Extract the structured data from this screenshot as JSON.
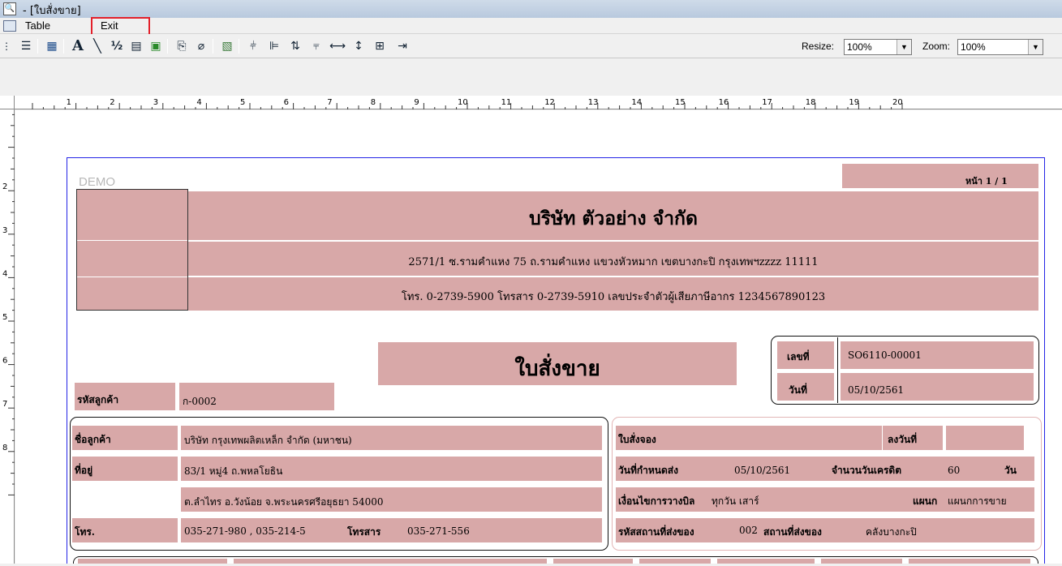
{
  "window": {
    "icon": "print-preview-icon",
    "title": "- [ใบสั่งขาย]"
  },
  "menu": {
    "items": [
      "Table",
      "Exit"
    ]
  },
  "toolbar": {
    "icons": [
      "grip-icon",
      "column-layout-icon",
      "table-icon",
      "text-icon",
      "line-icon",
      "percent-icon",
      "stripe-icon",
      "image-icon",
      "paste-icon",
      "eraser-icon",
      "chart-icon",
      "align-bottom-icon",
      "align-left-icon",
      "align-vertical-icon",
      "align-top-icon",
      "same-width-icon",
      "same-height-icon",
      "same-size-icon",
      "exit-door-icon"
    ],
    "resize_label": "Resize:",
    "resize_value": "100%",
    "zoom_label": "Zoom:",
    "zoom_value": "100%"
  },
  "ruler": {
    "h_numbers": [
      "1",
      "2",
      "3",
      "4",
      "5",
      "6",
      "7",
      "8",
      "9",
      "10",
      "11",
      "12",
      "13",
      "14",
      "15",
      "16",
      "17",
      "18",
      "19",
      "20"
    ],
    "v_numbers": [
      "2",
      "3",
      "4",
      "5",
      "6",
      "7",
      "8"
    ]
  },
  "report": {
    "watermark": "DEMO",
    "page_num": "หน้า 1 / 1",
    "company": "บริษัท ตัวอย่าง จำกัด",
    "address": "2571/1 ซ.รามคำแหง 75 ถ.รามคำแหง แขวงหัวหมาก เขตบางกะปิ กรุงเทพฯzzzz 11111",
    "contact": "โทร. 0-2739-5900   โทรสาร 0-2739-5910   เลขประจำตัวผู้เสียภาษีอากร 1234567890123",
    "doc_title": "ใบสั่งขาย",
    "doc_no_label": "เลขที่",
    "doc_no": "SO6110-00001",
    "date_label": "วันที่",
    "date": "05/10/2561",
    "cust_code_label": "รหัสลูกค้า",
    "cust_code": "ก-0002",
    "cust_name_label": "ชื่อลูกค้า",
    "cust_name": "บริษัท กรุงเทพผลิตเหล็ก จำกัด (มหาชน)",
    "addr_label": "ที่อยู่",
    "addr1": "83/1 หมู่4 ถ.พหลโยธิน",
    "addr2": "ต.ลำไทร อ.วังน้อย จ.พระนครศรีอยุธยา 54000",
    "tel_label": "โทร.",
    "tel": "035-271-980 , 035-214-5",
    "fax_label": "โทรสาร",
    "fax": "035-271-556",
    "po_label": "ใบสั่งจอง",
    "po_date_label": "ลงวันที่",
    "due_label": "วันที่กำหนดส่ง",
    "due": "05/10/2561",
    "credit_label": "จำนวนวันเครดิต",
    "credit": "60",
    "credit_unit": "วัน",
    "bill_label": "เงื่อนไขการวางบิล",
    "bill": "ทุกวัน เสาร์",
    "dept_label": "แผนก",
    "dept": "แผนกการขาย",
    "ship_code_label": "รหัสสถานที่ส่งของ",
    "ship_code": "002",
    "ship_label": "สถานที่ส่งของ",
    "ship": "คลังบางกะปิ"
  }
}
